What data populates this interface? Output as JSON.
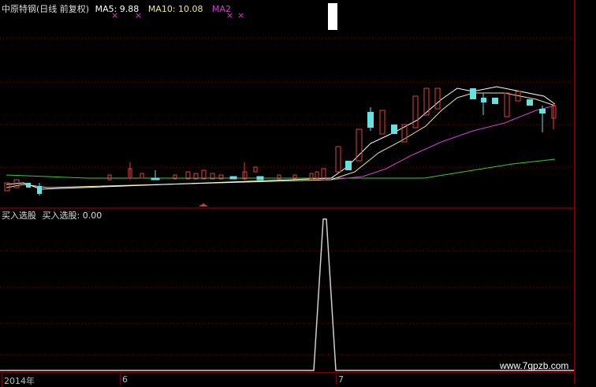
{
  "main_header": {
    "stock_name": "中原特钢",
    "period_info": "(日线 前复权)",
    "ma5_label": "MA5: 9.88",
    "ma10_label": "MA10: 10.08",
    "ma20_label": "MA2"
  },
  "sub_header": {
    "indicator": "买入选股",
    "indicator_value": "买入选股: 0.00"
  },
  "markers": {
    "x_mark": "×"
  },
  "time_axis": {
    "year_label": "2014年",
    "month_6": "6",
    "month_7": "7"
  },
  "watermark": "www.7gpzb.com",
  "colors": {
    "ma5": "#ffffff",
    "ma10": "#f0e68c",
    "ma20": "#d040d0",
    "ma60": "#33cc33",
    "up": "#e04040",
    "down": "#66e0e0",
    "grid": "#8b0000",
    "signal": "#cfcfcf"
  }
}
